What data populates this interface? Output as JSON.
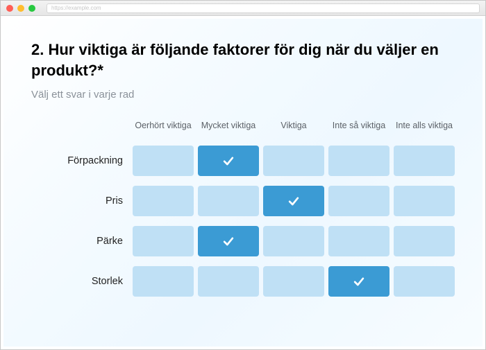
{
  "browser": {
    "url_placeholder": "https://example.com"
  },
  "question": {
    "title": "2. Hur viktiga är följande faktorer för dig när du väljer en produkt?*",
    "instruction": "Välj ett svar i varje rad"
  },
  "columns": [
    {
      "label": "Oerhört viktiga"
    },
    {
      "label": "Mycket viktiga"
    },
    {
      "label": "Viktiga"
    },
    {
      "label": "Inte så viktiga"
    },
    {
      "label": "Inte alls viktiga"
    }
  ],
  "rows": [
    {
      "label": "Förpackning",
      "selected": 1
    },
    {
      "label": "Pris",
      "selected": 2
    },
    {
      "label": "Pärke",
      "selected": 1
    },
    {
      "label": "Storlek",
      "selected": 3
    }
  ],
  "colors": {
    "cell_unselected": "#bfe0f5",
    "cell_selected": "#3b9bd4"
  }
}
